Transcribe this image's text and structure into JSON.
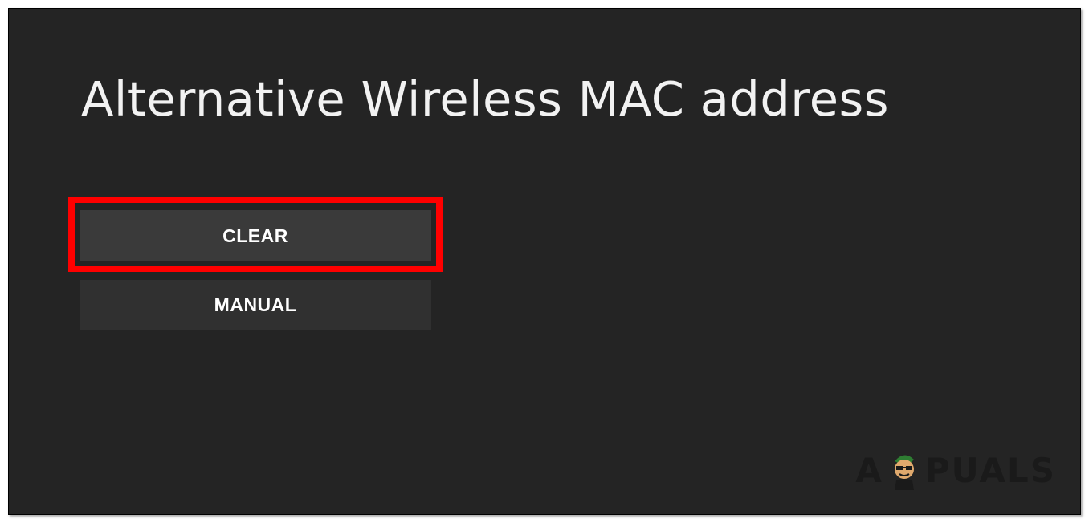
{
  "page": {
    "title": "Alternative Wireless MAC address"
  },
  "buttons": {
    "clear_label": "CLEAR",
    "manual_label": "MANUAL"
  },
  "watermark": {
    "left": "A",
    "right": "PUALS"
  },
  "colors": {
    "background": "#242424",
    "button": "#3a3a3a",
    "highlight": "#ff0000",
    "text": "#f2f2f2"
  }
}
